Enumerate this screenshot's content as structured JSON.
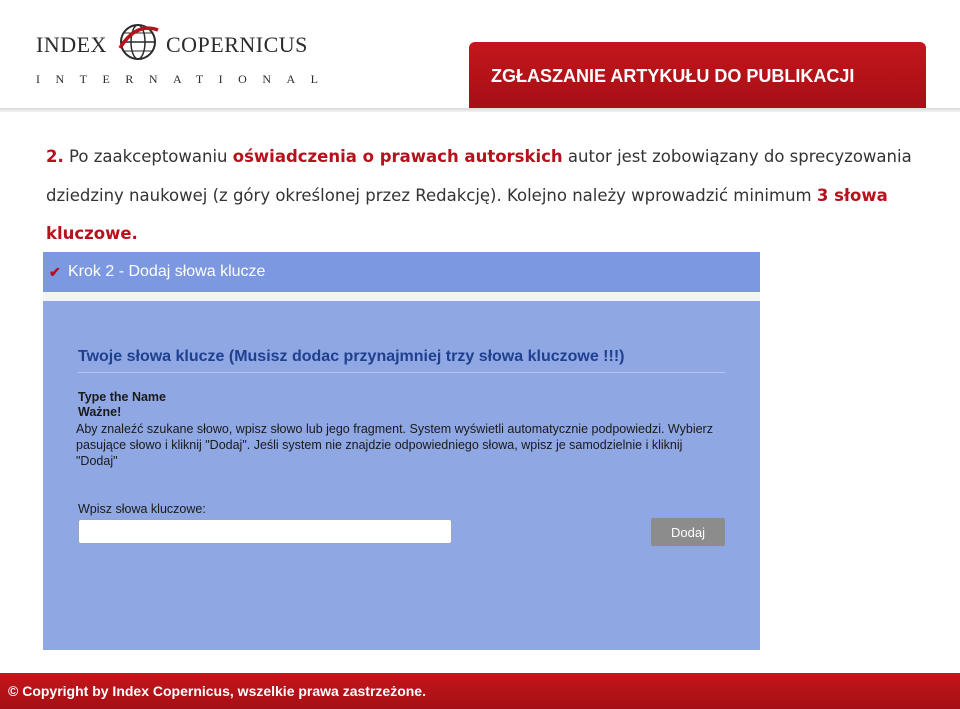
{
  "header": {
    "logo_word1": "INDEX",
    "logo_word2": "COPERNICUS",
    "logo_subtitle": "INTERNATIONAL",
    "title": "ZGŁASZANIE ARTYKUŁU DO PUBLIKACJI",
    "brand_color": "#b5121b"
  },
  "instruction": {
    "number": "2.",
    "part1": "Po zaakceptowaniu",
    "highlight1": "oświadczenia o prawach autorskich",
    "part2": "autor jest zobowiązany do sprecyzowania dziedziny naukowej (z góry określonej przez Redakcję). Kolejno należy wprowadzić minimum",
    "highlight2": "3 słowa kluczowe."
  },
  "screenshot": {
    "step_icon": "check-icon",
    "step_title": "Krok 2 - Dodaj słowa klucze",
    "section_title": "Twoje słowa klucze  (Musisz dodac przynajmniej trzy słowa kluczowe !!!)",
    "name_label": "Type the Name",
    "note_label": "Ważne!",
    "note_text": "Aby znaleźć szukane słowo, wpisz słowo lub jego fragment. System wyświetli automatycznie podpowiedzi. Wybierz pasujące słowo i kliknij \"Dodaj\". Jeśli system nie znajdzie odpowiedniego słowa, wpisz je samodzielnie i kliknij \"Dodaj\"",
    "input_label": "Wpisz słowa kluczowe:",
    "input_value": "",
    "button_label": "Dodaj"
  },
  "footer": {
    "copyright": "© Copyright by Index Copernicus, wszelkie prawa zastrzeżone."
  }
}
